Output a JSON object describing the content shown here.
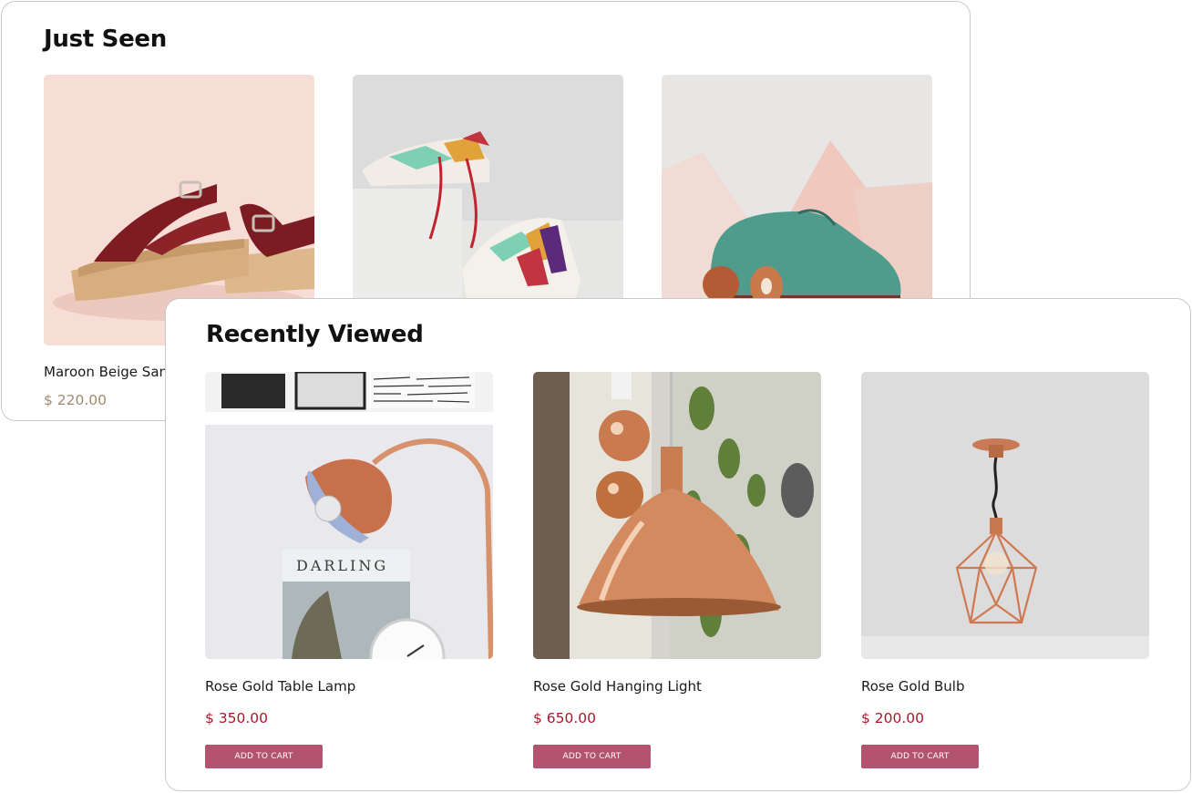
{
  "just_seen": {
    "title": "Just Seen",
    "products": [
      {
        "name": "Maroon Beige Sandals",
        "price": "$ 220.00",
        "image": "maroon-sandals-photo"
      },
      {
        "name": "",
        "price": "",
        "image": "colorful-sneakers-photo"
      },
      {
        "name": "",
        "price": "",
        "image": "teal-suede-shoe-photo"
      }
    ]
  },
  "recently_viewed": {
    "title": "Recently Viewed",
    "add_to_cart_label": "ADD TO CART",
    "products": [
      {
        "name": "Rose Gold Table Lamp",
        "price": "$ 350.00",
        "image": "rose-gold-table-lamp-photo"
      },
      {
        "name": "Rose Gold Hanging Light",
        "price": "$ 650.00",
        "image": "rose-gold-hanging-light-photo"
      },
      {
        "name": "Rose Gold Bulb",
        "price": "$ 200.00",
        "image": "rose-gold-bulb-photo"
      }
    ]
  },
  "colors": {
    "button": "#b25470",
    "price_accent": "#b0142d",
    "price_muted": "#a08a6e",
    "panel_border": "#c9c9cc"
  }
}
